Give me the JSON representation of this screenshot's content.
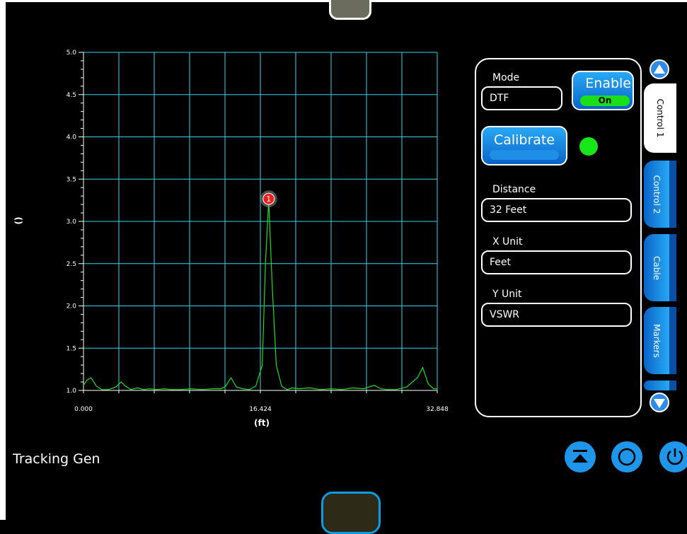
{
  "footer": {
    "title": "Tracking Gen"
  },
  "chart_data": {
    "type": "line",
    "ylabel": "()",
    "xlabel": "(ft)",
    "ylim": [
      1.0,
      5.0
    ],
    "xlim": [
      0.0,
      32.848
    ],
    "y_ticks": [
      "1.0",
      "1.5",
      "2.0",
      "2.5",
      "3.0",
      "3.5",
      "4.0",
      "4.5",
      "5.0"
    ],
    "x_ticks": [
      "0.000",
      "16.424",
      "32.848"
    ],
    "grid": true,
    "line_color": "#22dd22",
    "grid_color": "#33d6e6",
    "series": [
      {
        "x": [
          0.0,
          0.3,
          0.7,
          1.2,
          1.7,
          2.3,
          3.0,
          3.5,
          3.9,
          4.4,
          5.0,
          5.6,
          6.2,
          6.8,
          7.5,
          8.2,
          9.0,
          10.0,
          11.0,
          12.0,
          12.8,
          13.2,
          13.7,
          14.2,
          14.8,
          15.4,
          16.0,
          16.6,
          16.9,
          17.2,
          17.5,
          17.9,
          18.4,
          18.9,
          19.4,
          20.0,
          21.0,
          22.0,
          23.0,
          24.0,
          25.0,
          26.0,
          27.0,
          27.6,
          28.2,
          29.0,
          30.0,
          31.0,
          31.5,
          32.0,
          32.5,
          32.848
        ],
        "values": [
          1.06,
          1.12,
          1.15,
          1.05,
          1.01,
          1.01,
          1.04,
          1.1,
          1.05,
          1.01,
          1.03,
          1.01,
          1.02,
          1.01,
          1.02,
          1.01,
          1.01,
          1.02,
          1.01,
          1.02,
          1.02,
          1.05,
          1.15,
          1.04,
          1.02,
          1.01,
          1.05,
          1.3,
          2.5,
          3.25,
          2.3,
          1.3,
          1.05,
          1.01,
          1.03,
          1.02,
          1.03,
          1.01,
          1.02,
          1.01,
          1.03,
          1.02,
          1.06,
          1.02,
          1.01,
          1.01,
          1.04,
          1.15,
          1.27,
          1.08,
          1.02,
          1.02
        ]
      }
    ],
    "marker": {
      "label": "1",
      "x": 17.2,
      "y": 3.25,
      "color": "#e62020"
    }
  },
  "panel": {
    "mode_label": "Mode",
    "mode_value": "DTF",
    "enable_label": "Enable",
    "enable_state": "On",
    "calibrate_label": "Calibrate",
    "status_color": "#18e618",
    "distance_label": "Distance",
    "distance_value": "32 Feet",
    "xunit_label": "X Unit",
    "xunit_value": "Feet",
    "yunit_label": "Y Unit",
    "yunit_value": "VSWR"
  },
  "tabs": [
    "Control 1",
    "Control 2",
    "Cable",
    "Markers"
  ],
  "icons": {
    "scroll_up": "triangle-up-icon",
    "scroll_down": "triangle-down-icon",
    "bottom_buttons": [
      "eject-icon",
      "circle-icon",
      "power-icon"
    ]
  }
}
